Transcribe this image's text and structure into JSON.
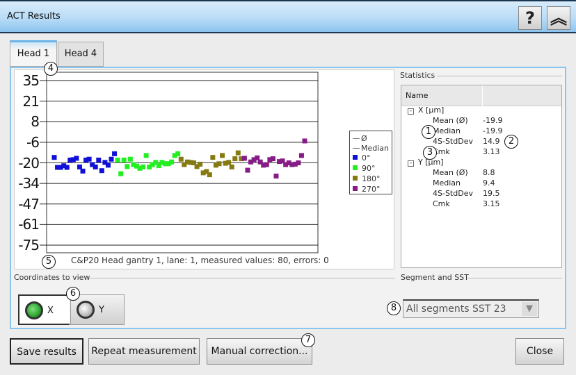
{
  "window": {
    "title": "ACT Results",
    "help_label": "?",
    "collapse_label": "︽"
  },
  "tabs": [
    {
      "label": "Head 1",
      "selected": true
    },
    {
      "label": "Head 4",
      "selected": false
    }
  ],
  "chart_data": {
    "type": "scatter",
    "yticks": [
      35,
      21,
      8,
      -6,
      -20,
      -34,
      -47,
      -61,
      -75
    ],
    "ylim": [
      -75,
      35
    ],
    "caption": "C&P20 Head gantry 1, lane: 1, measured values: 80,  errors: 0",
    "mean": -19.9,
    "median": -19.9,
    "legend": [
      {
        "label": "Ø",
        "kind": "line",
        "color": "#999999"
      },
      {
        "label": "Median",
        "kind": "line",
        "color": "#666666"
      }
    ],
    "series": [
      {
        "name": "0°",
        "color": "#1010d8",
        "values": [
          -16.3,
          -23.1,
          -23.1,
          -22,
          -23.1,
          -18.1,
          -17.8,
          -16.9,
          -22.8,
          -25.6,
          -18.1,
          -17.5,
          -21.2,
          -22.8,
          -18.1,
          -25.3,
          -19.7,
          -21.6,
          -17.5,
          -13.8
        ]
      },
      {
        "name": "90°",
        "color": "#22ee22",
        "values": [
          -18.1,
          -27.4,
          -18.1,
          -22.5,
          -17.5,
          -21.2,
          -22.2,
          -23.7,
          -22.8,
          -15.0,
          -22.8,
          -21.2,
          -19.7,
          -21.9,
          -19.7,
          -20.6,
          -20.6,
          -19.4,
          -15.0,
          -13.8
        ]
      },
      {
        "name": "180°",
        "color": "#857a12",
        "values": [
          -17.5,
          -21.2,
          -19.4,
          -19.7,
          -20,
          -22.5,
          -20.9,
          -26.8,
          -25.9,
          -28.1,
          -16.3,
          -21.6,
          -20.6,
          -15.0,
          -20.3,
          -19.7,
          -22.8,
          -17.2,
          -13.2,
          -17.2
        ]
      },
      {
        "name": "270°",
        "color": "#861c86",
        "values": [
          -16.9,
          -25,
          -19.4,
          -17.8,
          -16.6,
          -19.4,
          -21.6,
          -21.2,
          -17.8,
          -17.2,
          -29,
          -19.1,
          -18.7,
          -21.2,
          -20,
          -21.2,
          -20.9,
          -20,
          -15,
          -5.1
        ]
      }
    ]
  },
  "statistics": {
    "group_label": "Statistics",
    "column_name": "Name",
    "groups": [
      {
        "label": "X [µm]",
        "expander": "-",
        "rows": [
          {
            "name": "Mean (Ø)",
            "value": "-19.9"
          },
          {
            "name": "Median",
            "value": "-19.9"
          },
          {
            "name": "4S-StdDev",
            "value": "14.9"
          },
          {
            "name": "Cmk",
            "value": "3.13"
          }
        ]
      },
      {
        "label": "Y [µm]",
        "expander": "-",
        "rows": [
          {
            "name": "Mean (Ø)",
            "value": "8.8"
          },
          {
            "name": "Median",
            "value": "9.4"
          },
          {
            "name": "4S-StdDev",
            "value": "19.5"
          },
          {
            "name": "Cmk",
            "value": "3.15"
          }
        ]
      }
    ]
  },
  "coordinates": {
    "group_label": "Coordinates to view",
    "x_label": "X",
    "y_label": "Y",
    "selected": "X",
    "active_color": "#2fa52f"
  },
  "segment": {
    "group_label": "Segment and SST",
    "value": "All segments SST 23",
    "arrow": "▼"
  },
  "buttons": {
    "save": "Save results",
    "repeat": "Repeat measurement",
    "manual": "Manual correction...",
    "close": "Close"
  },
  "annotations": [
    "1",
    "2",
    "3",
    "4",
    "5",
    "6",
    "7",
    "8"
  ]
}
